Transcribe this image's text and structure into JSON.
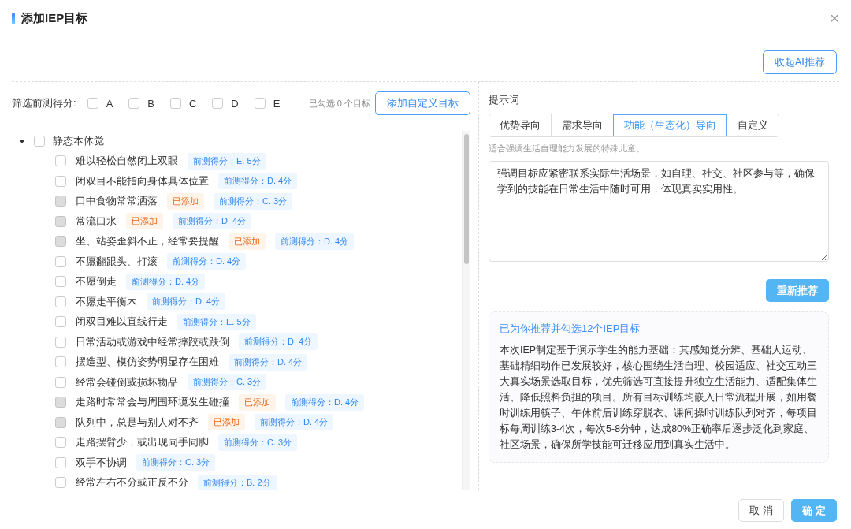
{
  "dialog": {
    "title": "添加IEP目标",
    "close_icon": "×"
  },
  "collapse_ai_button": "收起AI推荐",
  "filter": {
    "label": "筛选前测得分:",
    "options": [
      {
        "label": "A",
        "checked": false
      },
      {
        "label": "B",
        "checked": false
      },
      {
        "label": "C",
        "checked": false
      },
      {
        "label": "D",
        "checked": false
      },
      {
        "label": "E",
        "checked": false
      }
    ],
    "selected_count": "已勾选 0 个目标",
    "add_custom_button": "添加自定义目标"
  },
  "tree": [
    {
      "label": "静态本体觉",
      "checked": false,
      "expanded": true,
      "children": [
        {
          "label": "难以轻松自然闭上双眼",
          "checked": false,
          "disabled": false,
          "score": "前测得分：E. 5分"
        },
        {
          "label": "闭双目不能指向身体具体位置",
          "checked": false,
          "disabled": false,
          "score": "前测得分：D. 4分"
        },
        {
          "label": "口中食物常常洒落",
          "checked": false,
          "disabled": true,
          "added_tag": "已添加",
          "score": "前测得分：C. 3分"
        },
        {
          "label": "常流口水",
          "checked": false,
          "disabled": true,
          "added_tag": "已添加",
          "score": "前测得分：D. 4分"
        },
        {
          "label": "坐、站姿歪斜不正，经常要提醒",
          "checked": false,
          "disabled": true,
          "added_tag": "已添加",
          "score": "前测得分：D. 4分"
        },
        {
          "label": "不愿翻跟头、打滚",
          "checked": false,
          "disabled": false,
          "score": "前测得分：D. 4分"
        },
        {
          "label": "不愿倒走",
          "checked": false,
          "disabled": false,
          "score": "前测得分：D. 4分"
        },
        {
          "label": "不愿走平衡木",
          "checked": false,
          "disabled": false,
          "score": "前测得分：D. 4分"
        },
        {
          "label": "闭双目难以直线行走",
          "checked": false,
          "disabled": false,
          "score": "前测得分：E. 5分"
        },
        {
          "label": "日常活动或游戏中经常摔跤或跌倒",
          "checked": false,
          "disabled": false,
          "score": "前测得分：D. 4分"
        },
        {
          "label": "摆造型、模仿姿势明显存在困难",
          "checked": false,
          "disabled": false,
          "score": "前测得分：D. 4分"
        },
        {
          "label": "经常会碰倒或损坏物品",
          "checked": false,
          "disabled": false,
          "score": "前测得分：C. 3分"
        },
        {
          "label": "走路时常常会与周围环境发生碰撞",
          "checked": false,
          "disabled": true,
          "added_tag": "已添加",
          "score": "前测得分：D. 4分"
        },
        {
          "label": "队列中，总是与别人对不齐",
          "checked": false,
          "disabled": true,
          "added_tag": "已添加",
          "score": "前测得分：D. 4分"
        },
        {
          "label": "走路摆臂少，或出现同手同脚",
          "checked": false,
          "disabled": false,
          "score": "前测得分：C. 3分"
        },
        {
          "label": "双手不协调",
          "checked": false,
          "disabled": false,
          "score": "前测得分：C. 3分"
        },
        {
          "label": "经常左右不分或正反不分",
          "checked": false,
          "disabled": false,
          "score": "前测得分：B. 2分"
        }
      ]
    }
  ],
  "prompt": {
    "label": "提示词",
    "tabs": [
      {
        "label": "优势导向",
        "selected": false
      },
      {
        "label": "需求导向",
        "selected": false
      },
      {
        "label": "功能（生态化）导向",
        "selected": true
      },
      {
        "label": "自定义",
        "selected": false
      }
    ],
    "hint": "适合强调生活自理能力发展的特殊儿童。",
    "value": "强调目标应紧密联系实际生活场景，如自理、社交、社区参与等，确保学到的技能在日常生活中随时可用，体现真实实用性。",
    "regenerate_button": "重新推荐"
  },
  "result": {
    "title": "已为你推荐并勾选12个IEP目标",
    "text": "本次IEP制定基于演示学生的能力基础：其感知觉分辨、基础大运动、基础精细动作已发展较好，核心围绕生活自理、校园适应、社交互动三大真实场景选取目标，优先筛选可直接提升独立生活能力、适配集体生活、降低照料负担的项目。所有目标训练均嵌入日常流程开展，如用餐时训练用筷子、午休前后训练穿脱衣、课间操时训练队列对齐，每项目标每周训练3-4次，每次5-8分钟，达成80%正确率后逐步泛化到家庭、社区场景，确保所学技能可迁移应用到真实生活中。"
  },
  "footer": {
    "cancel_button": "取 消",
    "confirm_button": "确 定"
  }
}
